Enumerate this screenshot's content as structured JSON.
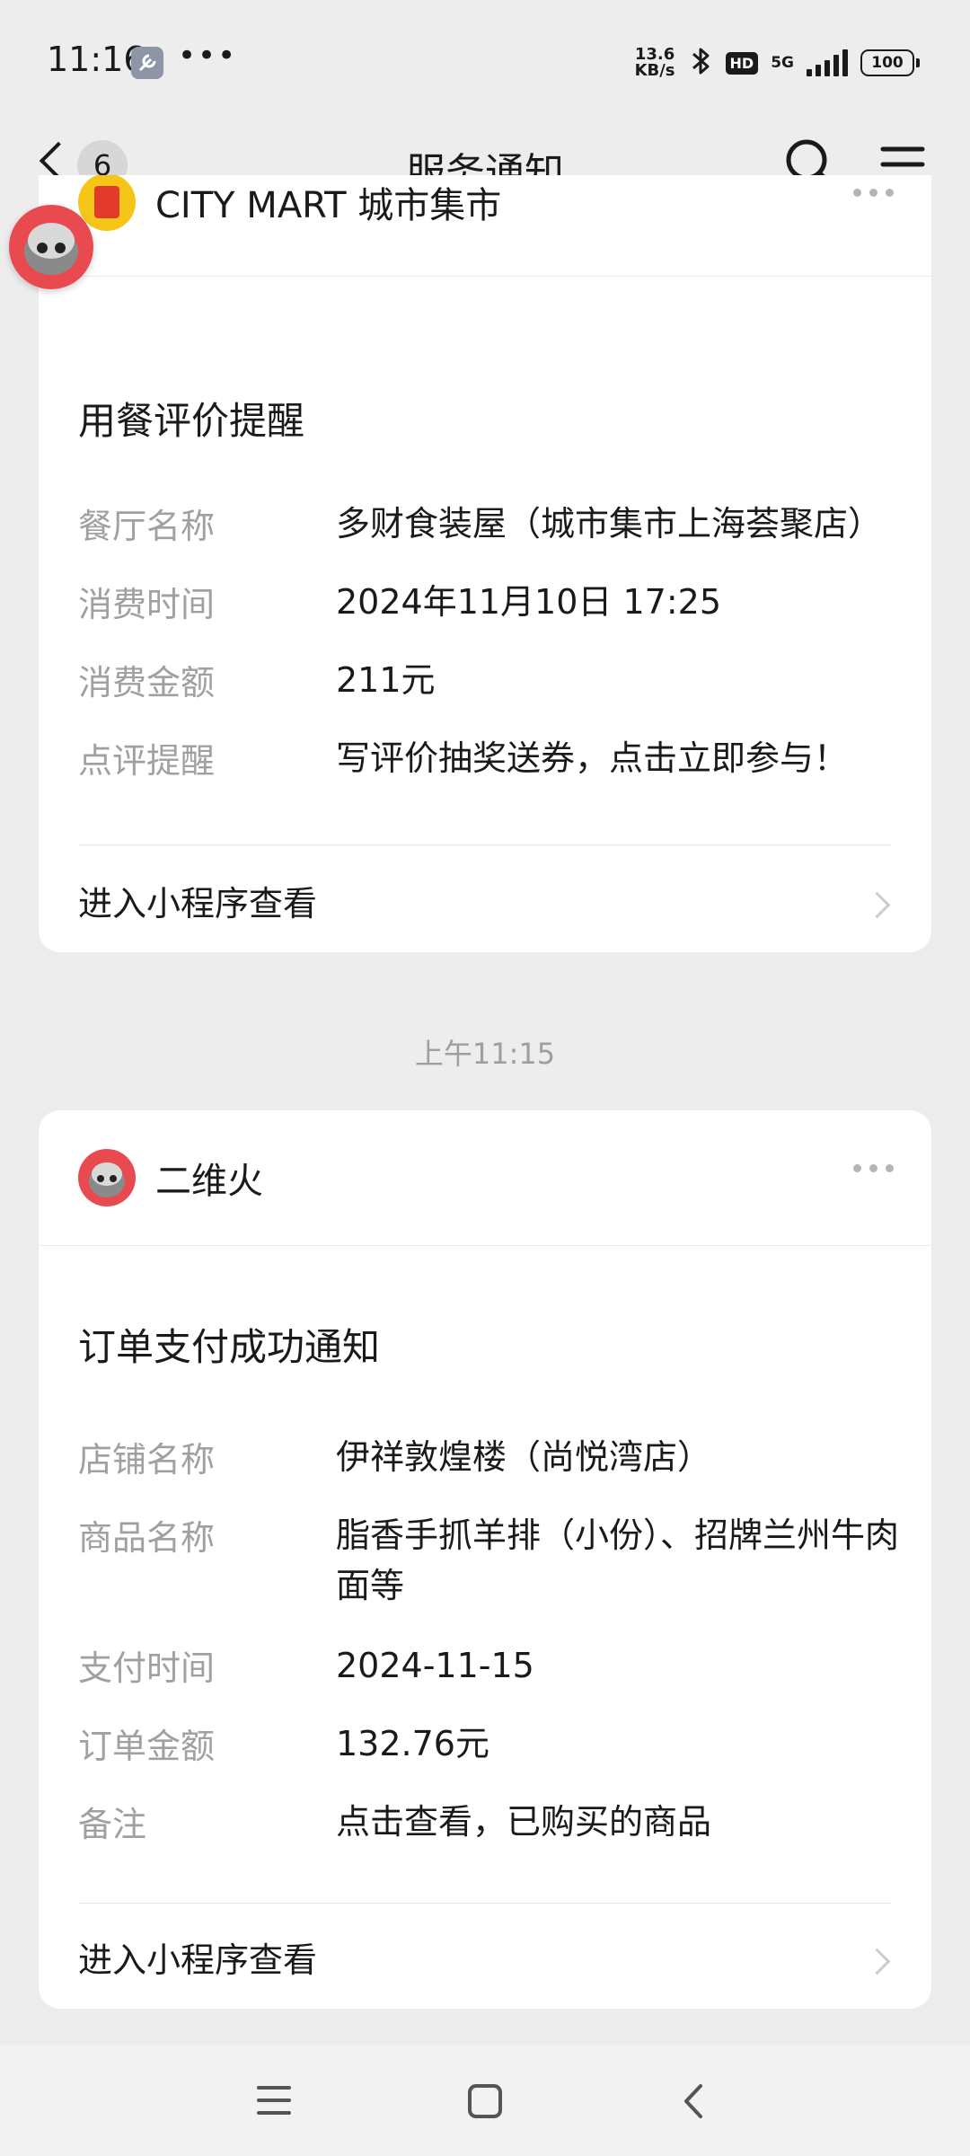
{
  "status_bar": {
    "time": "11:16",
    "net_speed_value": "13.6",
    "net_speed_unit": "KB/s",
    "hd": "HD",
    "network": "5G",
    "battery": "100",
    "icons": [
      "settings-wrench-icon",
      "more-dots-icon",
      "bluetooth-icon",
      "signal-icon",
      "battery-icon"
    ]
  },
  "header": {
    "back_badge": "6",
    "title": "服务通知"
  },
  "card1": {
    "sender": "CITY MART 城市集市",
    "title": "用餐评价提醒",
    "fields": [
      {
        "label": "餐厅名称",
        "value": "多财食装屋（城市集市上海荟聚店）"
      },
      {
        "label": "消费时间",
        "value": "2024年11月10日 17:25"
      },
      {
        "label": "消费金额",
        "value": "211元"
      },
      {
        "label": "点评提醒",
        "value": "写评价抽奖送券，点击立即参与！"
      }
    ],
    "link": "进入小程序查看"
  },
  "timestamp": "上午11:15",
  "card2": {
    "sender": "二维火",
    "title": "订单支付成功通知",
    "fields": [
      {
        "label": "店铺名称",
        "value": "伊祥敦煌楼（尚悦湾店）"
      },
      {
        "label": "商品名称",
        "value": "脂香手抓羊排（小份）、招牌兰州牛肉面等"
      },
      {
        "label": "支付时间",
        "value": "2024-11-15"
      },
      {
        "label": "订单金额",
        "value": "132.76元"
      },
      {
        "label": "备注",
        "value": "点击查看，已购买的商品"
      }
    ],
    "link": "进入小程序查看"
  },
  "nav": [
    "menu-icon",
    "home-icon",
    "back-icon"
  ]
}
